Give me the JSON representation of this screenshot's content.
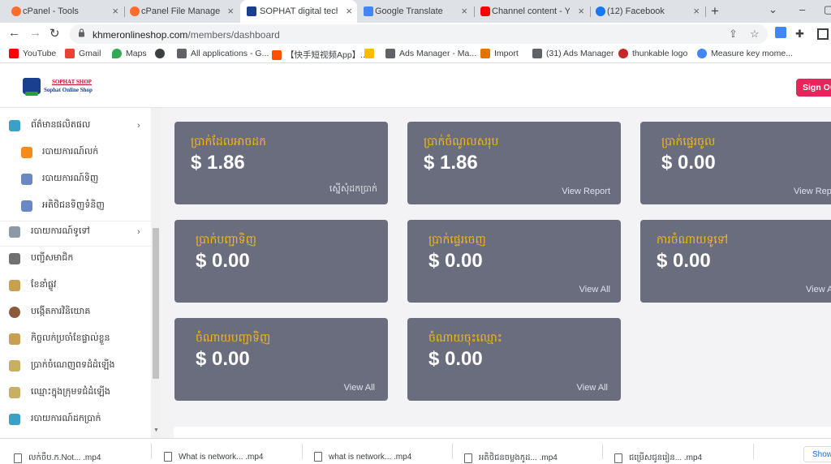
{
  "browser": {
    "tabs": [
      {
        "title": "cPanel - Tools",
        "active": false,
        "favicon_color": "#ff6c2c"
      },
      {
        "title": "cPanel File Manager v",
        "active": false,
        "favicon_color": "#ff6c2c"
      },
      {
        "title": "SOPHAT digital techn",
        "active": true,
        "favicon_color": "#1b3f8f"
      },
      {
        "title": "Google Translate",
        "active": false,
        "favicon_color": "#4285f4"
      },
      {
        "title": "Channel content - You",
        "active": false,
        "favicon_color": "#ff0000"
      },
      {
        "title": "(12) Facebook",
        "active": false,
        "favicon_color": "#1877f2"
      }
    ],
    "close_glyph": "×",
    "new_tab_glyph": "+",
    "window_controls": [
      "⌄",
      "–",
      "▢"
    ],
    "address": {
      "domain": "khmeronlineshop.com",
      "path": "/members/dashboard"
    },
    "bookmarks": [
      {
        "label": "YouTube",
        "icon": "youtube-icon",
        "color": "#ff0000"
      },
      {
        "label": "Gmail",
        "icon": "gmail-icon",
        "color": "#ea4335"
      },
      {
        "label": "Maps",
        "icon": "maps-icon",
        "color": "#34a853"
      },
      {
        "label": "",
        "icon": "globe-icon",
        "color": "#3c4043"
      },
      {
        "label": "All applications - G...",
        "icon": "apps-icon",
        "color": "#5f6368"
      },
      {
        "label": "【快手短视频App】...",
        "icon": "kuaishou-icon",
        "color": "#ff5000"
      },
      {
        "label": "",
        "icon": "drive-icon",
        "color": "#fbbc04"
      },
      {
        "label": "Ads Manager - Ma...",
        "icon": "page-icon",
        "color": "#5f6368"
      },
      {
        "label": "Import",
        "icon": "import-icon",
        "color": "#e37400"
      },
      {
        "label": "(31) Ads Manager",
        "icon": "page-icon",
        "color": "#5f6368"
      },
      {
        "label": "thunkable logo",
        "icon": "thunkable-icon",
        "color": "#c62828"
      },
      {
        "label": "Measure key mome...",
        "icon": "google-icon",
        "color": "#4285f4"
      }
    ],
    "downloads": [
      {
        "name": "លក់ចឹប.ក.Not... .mp4"
      },
      {
        "name": "What is network... .mp4"
      },
      {
        "name": "what is network... .mp4"
      },
      {
        "name": "អតិថិជនចម្លងកូដ... .mp4"
      },
      {
        "name": "ជម្រើសជូនរៀន... .mp4"
      }
    ],
    "show_all_label": "Show"
  },
  "site": {
    "logo": {
      "line1": "SOPHAT SHOP",
      "line2": "Sophat Online Shop"
    },
    "signout_label": "Sign Out",
    "sidebar": {
      "items": [
        {
          "label": "ព័ត៌មានផលិតផល",
          "icon": "product-info-icon",
          "color": "#3aa0c9",
          "type": "top",
          "has_chevron": true
        },
        {
          "label": "របាយការណ៍លក់",
          "icon": "sales-report-icon",
          "color": "#f28c1a",
          "type": "sub",
          "has_chevron": false
        },
        {
          "label": "របាយការណ៍ទិញ",
          "icon": "purchase-report-icon",
          "color": "#6a88c4",
          "type": "sub",
          "has_chevron": false
        },
        {
          "label": "អតិថិជនទិញទំនិញ",
          "icon": "customer-purchase-icon",
          "color": "#6a88c4",
          "type": "sub",
          "has_chevron": false
        },
        {
          "label": "របាយការណ៍ទូទៅ",
          "icon": "general-report-icon",
          "color": "#8c9aa8",
          "type": "top",
          "has_chevron": true
        },
        {
          "label": "បញ្ជីសមាជិក",
          "icon": "member-list-icon",
          "color": "#707070",
          "type": "top",
          "has_chevron": false
        },
        {
          "label": "ខែនាំផ្លូវ",
          "icon": "referral-icon",
          "color": "#c8a050",
          "type": "top",
          "has_chevron": false
        },
        {
          "label": "បង្កើតការវិនិយោគ",
          "icon": "investment-icon",
          "color": "#8a5a3a",
          "type": "top",
          "has_chevron": false
        },
        {
          "label": "កិច្ចលក់ប្រចាំខែផ្ទាល់ខ្លួន",
          "icon": "monthly-sales-icon",
          "color": "#c8a050",
          "type": "top",
          "has_chevron": false
        },
        {
          "label": "ប្រាក់ចំណេញពទដំដំឡើង",
          "icon": "profit-icon",
          "color": "#c8b060",
          "type": "top",
          "has_chevron": false
        },
        {
          "label": "ឈ្មោះក្នុងក្រុមទជំដំឡើង",
          "icon": "team-icon",
          "color": "#c8b060",
          "type": "top",
          "has_chevron": false
        },
        {
          "label": "របាយការណ៍ដកប្រាក់",
          "icon": "withdraw-report-icon",
          "color": "#3aa0c9",
          "type": "top",
          "has_chevron": false
        }
      ]
    },
    "cards": [
      {
        "title": "ប្រាក់ដែលអាចដក",
        "value": "$ 1.86",
        "link": "ស្នើសុំដកប្រាក់"
      },
      {
        "title": "ប្រាក់ចំណូលសរុប",
        "value": "$ 1.86",
        "link": "View Report"
      },
      {
        "title": "ប្រាក់ផ្ទេរចូល",
        "value": "$ 0.00",
        "link": "View Report"
      },
      {
        "title": "ប្រាក់បញ្ជាទិញ",
        "value": "$ 0.00",
        "link": ""
      },
      {
        "title": "ប្រាក់ផ្ទេរចេញ",
        "value": "$ 0.00",
        "link": "View All"
      },
      {
        "title": "ការចំណាយទូទៅ",
        "value": "$ 0.00",
        "link": "View All"
      },
      {
        "title": "ចំណាយបញ្ជាទិញ",
        "value": "$ 0.00",
        "link": "View All"
      },
      {
        "title": "ចំណាយចុះឈ្មោះ",
        "value": "$ 0.00",
        "link": "View All"
      }
    ]
  }
}
